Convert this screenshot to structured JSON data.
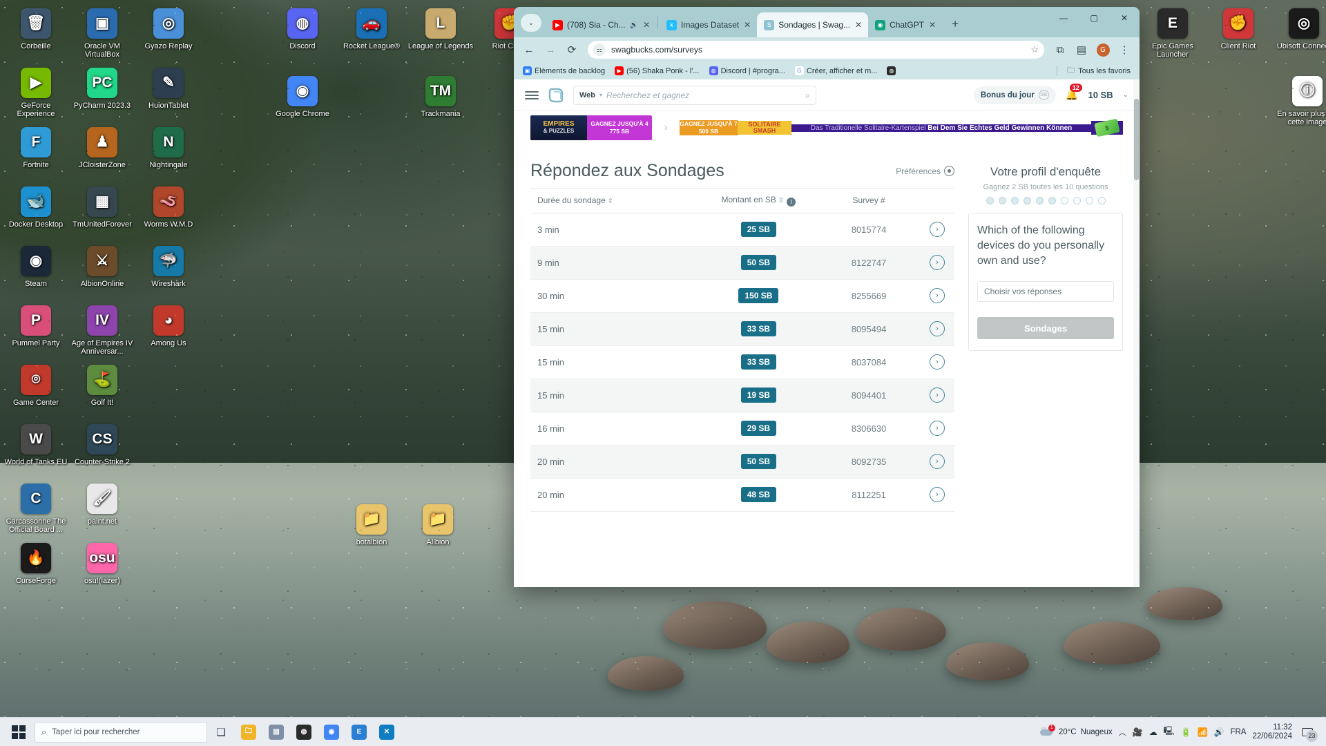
{
  "desktop": {
    "icons_col1": [
      {
        "label": "Corbeille",
        "glyph": "🗑",
        "color": "#3d566e"
      },
      {
        "label": "GeForce Experience",
        "glyph": "▶",
        "color": "#76b900"
      },
      {
        "label": "Fortnite",
        "glyph": "F",
        "color": "#2f9bd6"
      },
      {
        "label": "Docker Desktop",
        "glyph": "🐋",
        "color": "#1d91d0"
      },
      {
        "label": "Steam",
        "glyph": "◉",
        "color": "#1b2838"
      },
      {
        "label": "Pummel Party",
        "glyph": "P",
        "color": "#d94f7a"
      },
      {
        "label": "Game Center",
        "glyph": "⌾",
        "color": "#c0392b"
      },
      {
        "label": "World of Tanks EU",
        "glyph": "W",
        "color": "#4a4a4a"
      },
      {
        "label": "Carcassonne The Official Board ...",
        "glyph": "C",
        "color": "#2c6fa8"
      },
      {
        "label": "CurseForge",
        "glyph": "🔥",
        "color": "#1b1b1b"
      }
    ],
    "icons_col2": [
      {
        "label": "Oracle VM VirtualBox",
        "glyph": "▣",
        "color": "#2b6cb0"
      },
      {
        "label": "PyCharm 2023.3",
        "glyph": "PC",
        "color": "#21d789"
      },
      {
        "label": "JCloisterZone",
        "glyph": "♟",
        "color": "#b5651d"
      },
      {
        "label": "TmUnitedForever",
        "glyph": "▦",
        "color": "#37474f"
      },
      {
        "label": "AlbionOnline",
        "glyph": "⚔",
        "color": "#6b4b2a"
      },
      {
        "label": "Age of Empires IV Anniversar...",
        "glyph": "IV",
        "color": "#8e44ad"
      },
      {
        "label": "Golf It!",
        "glyph": "⛳",
        "color": "#5d8c3f"
      },
      {
        "label": "Counter-Strike 2",
        "glyph": "CS",
        "color": "#2f4858"
      },
      {
        "label": "paint.net",
        "glyph": "🖌",
        "color": "#e8e8e8"
      },
      {
        "label": "osu!(lazer)",
        "glyph": "osu",
        "color": "#ff66aa"
      }
    ],
    "icons_col3": [
      {
        "label": "Gyazo Replay",
        "glyph": "◎",
        "color": "#4a90d9"
      },
      {
        "label": "HuionTablet",
        "glyph": "✎",
        "color": "#2c3e50"
      },
      {
        "label": "Nightingale",
        "glyph": "N",
        "color": "#1f6b4a"
      },
      {
        "label": "Worms W.M.D",
        "glyph": "🪱",
        "color": "#b0472a"
      },
      {
        "label": "Wireshark",
        "glyph": "🦈",
        "color": "#1679a7"
      },
      {
        "label": "Among Us",
        "glyph": "◕",
        "color": "#c0392b"
      }
    ],
    "icons_row_top": [
      {
        "label": "Discord",
        "glyph": "◍",
        "color": "#5865f2"
      },
      {
        "label": "Rocket League®",
        "glyph": "🚗",
        "color": "#1a6fb5"
      },
      {
        "label": "League of Legends",
        "glyph": "L",
        "color": "#c8aa6e"
      },
      {
        "label": "Riot Client",
        "glyph": "✊",
        "color": "#d13639"
      },
      {
        "label": "Google Chrome",
        "glyph": "◉",
        "color": "#4285f4"
      },
      {
        "label": "Trackmania",
        "glyph": "TM",
        "color": "#2e7d32"
      }
    ],
    "icons_folders": [
      {
        "label": "botalbion",
        "glyph": "📁",
        "color": "#e8c46a"
      },
      {
        "label": "Allbion",
        "glyph": "📁",
        "color": "#e8c46a"
      }
    ],
    "icons_right": [
      {
        "label": "Epic Games Launcher",
        "glyph": "E",
        "color": "#2a2a2a"
      },
      {
        "label": "Client Riot",
        "glyph": "✊",
        "color": "#d13639"
      },
      {
        "label": "Ubisoft Connect",
        "glyph": "◎",
        "color": "#1a1a1a"
      },
      {
        "label": "En savoir plus sur cette image",
        "glyph": "ⓘ",
        "color": "#ffffff"
      }
    ]
  },
  "browser": {
    "tabs": [
      {
        "title": "(708) Sia - Ch...",
        "favicon": "youtube-icon",
        "favicon_color": "#ff0000",
        "favicon_glyph": "▶",
        "active": false,
        "muted": true
      },
      {
        "title": "Images Dataset",
        "favicon": "kaggle-icon",
        "favicon_color": "#20beff",
        "favicon_glyph": "k",
        "active": false,
        "muted": false
      },
      {
        "title": "Sondages | Swag...",
        "favicon": "swagbucks-icon",
        "favicon_color": "#8fc3d4",
        "favicon_glyph": "S",
        "active": true,
        "muted": false
      },
      {
        "title": "ChatGPT",
        "favicon": "openai-icon",
        "favicon_color": "#10a37f",
        "favicon_glyph": "◉",
        "active": false,
        "muted": false
      }
    ],
    "new_tab_label": "+",
    "tab_list_label": "⌄",
    "window_controls": {
      "minimize": "—",
      "maximize": "▢",
      "close": "✕"
    },
    "nav": {
      "back": "←",
      "forward": "→",
      "reload": "⟳"
    },
    "omnibox": {
      "site_settings_icon": "tune-icon",
      "url": "swagbucks.com/surveys",
      "bookmark_icon": "☆"
    },
    "toolbar_right": {
      "extensions_icon": "⧉",
      "split_icon": "▤",
      "profile_initial": "G",
      "menu_icon": "⋮"
    },
    "bookmarks": [
      {
        "label": "Éléments de backlog",
        "color": "#2d7ff9",
        "glyph": "▣"
      },
      {
        "label": "(56) Shaka Ponk - l'...",
        "color": "#ff0000",
        "glyph": "▶"
      },
      {
        "label": "Discord | #progra...",
        "color": "#5865f2",
        "glyph": "◍"
      },
      {
        "label": "Créer, afficher et m...",
        "color": "#ffffff",
        "glyph": "G"
      },
      {
        "label": "",
        "color": "#2b2b2b",
        "glyph": "◍"
      }
    ],
    "bookmarks_all": {
      "label": "Tous les favoris",
      "glyph": "🗀"
    }
  },
  "swagbucks": {
    "header": {
      "menu_icon": "hamburger-icon",
      "logo_icon": "swagbucks-logo",
      "search_scope": "Web",
      "search_placeholder": "Recherchez et gagnez",
      "search_icon": "magnifier-icon",
      "bonus_label": "Bonus du jour",
      "bonus_coin": "SB",
      "notification_count": "12",
      "balance": "10 SB",
      "caret": "⌄"
    },
    "ads": {
      "ad1": {
        "brand_line1": "EMPIRES",
        "brand_line2": "& PUZZLES",
        "headline": "GAGNEZ JUSQU'À 4 775 SB"
      },
      "carousel_arrow": "›",
      "ad2": {
        "headline": "GAGNEZ JUSQU'À 7 500 SB",
        "art_label": "SOLITAIRE SMASH",
        "text_light": "Das Traditionelle Solitaire-Kartenspiel",
        "text_bold": "Bei Dem Sie Echtes Geld Gewinnen Können",
        "money": "$"
      }
    },
    "page_title": "Répondez aux Sondages",
    "preferences_label": "Préférences",
    "table": {
      "columns": [
        "Durée du sondage",
        "Montant en SB",
        "Survey #",
        ""
      ],
      "rows": [
        {
          "duration": "3 min",
          "amount": "25 SB",
          "number": "8015774",
          "go": "›"
        },
        {
          "duration": "9 min",
          "amount": "50 SB",
          "number": "8122747",
          "go": "›"
        },
        {
          "duration": "30 min",
          "amount": "150 SB",
          "number": "8255669",
          "go": "›"
        },
        {
          "duration": "15 min",
          "amount": "33 SB",
          "number": "8095494",
          "go": "›"
        },
        {
          "duration": "15 min",
          "amount": "33 SB",
          "number": "8037084",
          "go": "›"
        },
        {
          "duration": "15 min",
          "amount": "19 SB",
          "number": "8094401",
          "go": "›"
        },
        {
          "duration": "16 min",
          "amount": "29 SB",
          "number": "8306630",
          "go": "›"
        },
        {
          "duration": "20 min",
          "amount": "50 SB",
          "number": "8092735",
          "go": "›"
        },
        {
          "duration": "20 min",
          "amount": "48 SB",
          "number": "8112251",
          "go": "›"
        }
      ]
    },
    "profile_panel": {
      "title": "Votre profil d'enquête",
      "subtitle": "Gagnez 2 SB toutes les 10 questions",
      "dots_total": 10,
      "dots_filled": 6,
      "question": "Which of the following devices do you personally own and use?",
      "answer_placeholder": "Choisir vos réponses",
      "button_label": "Sondages"
    }
  },
  "taskbar": {
    "start_icon": "windows-icon",
    "search_placeholder": "Taper ici pour rechercher",
    "search_icon": "magnifier-icon",
    "task_view_icon": "task-view-icon",
    "pinned": [
      {
        "name": "file-explorer",
        "glyph": "🗀",
        "color": "#f0b429"
      },
      {
        "name": "photos",
        "glyph": "▤",
        "color": "#7f8fa6"
      },
      {
        "name": "media-player",
        "glyph": "◍",
        "color": "#2b2b2b"
      },
      {
        "name": "chrome",
        "glyph": "◉",
        "color": "#4285f4"
      },
      {
        "name": "epic-games",
        "glyph": "E",
        "color": "#2a7fd4"
      },
      {
        "name": "vscode",
        "glyph": "✕",
        "color": "#0f7dc2"
      }
    ],
    "weather": {
      "temp": "20°C",
      "condition": "Nuageux",
      "alert": "1"
    },
    "tray_icons": [
      "chevron-up-icon",
      "camera-icon",
      "cloud-sync-icon",
      "display-icon",
      "battery-icon",
      "wifi-icon",
      "volume-icon"
    ],
    "language": "FRA",
    "time": "11:32",
    "date": "22/06/2024",
    "notification_count": "23"
  }
}
